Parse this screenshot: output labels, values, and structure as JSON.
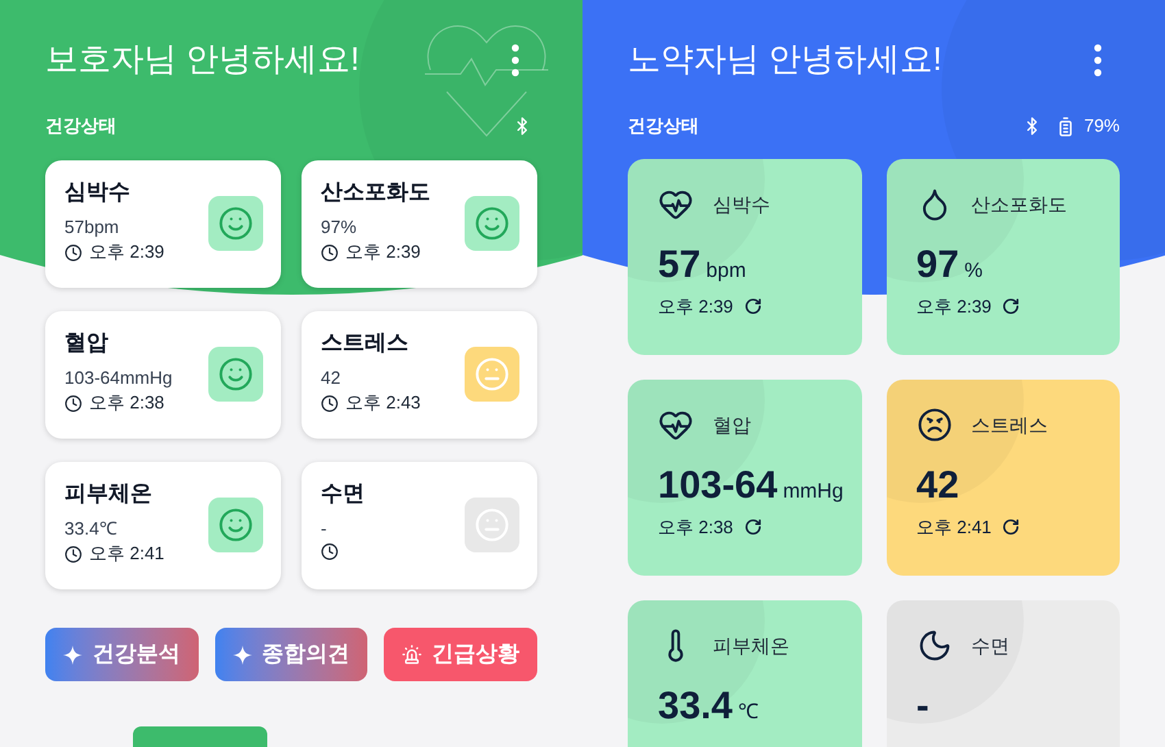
{
  "guardian": {
    "title": "보호자님 안녕하세요!",
    "section": "건강상태",
    "cards": [
      {
        "label": "심박수",
        "value": "57bpm",
        "time": "오후 2:39",
        "kind": "smile",
        "color": "#a3ecc2"
      },
      {
        "label": "산소포화도",
        "value": "97%",
        "time": "오후 2:39",
        "kind": "smile",
        "color": "#a3ecc2"
      },
      {
        "label": "혈압",
        "value": "103-64mmHg",
        "time": "오후 2:38",
        "kind": "smile",
        "color": "#a3ecc2"
      },
      {
        "label": "스트레스",
        "value": "42",
        "time": "오후 2:43",
        "kind": "neutral",
        "color": "#fdd97c"
      },
      {
        "label": "피부체온",
        "value": "33.4℃",
        "time": "오후 2:41",
        "kind": "smile",
        "color": "#a3ecc2"
      },
      {
        "label": "수면",
        "value": "-",
        "kind": "neutral",
        "color": "#e8e8e8"
      }
    ],
    "buttons": [
      {
        "label": "건강분석",
        "kind": "ai"
      },
      {
        "label": "종합의견",
        "kind": "ai"
      },
      {
        "label": "긴급상황",
        "kind": "emergency"
      }
    ]
  },
  "elder": {
    "title": "노약자님 안녕하세요!",
    "section": "건강상태",
    "battery": "79%",
    "cards": [
      {
        "kind": "heart_rate",
        "label": "심박수",
        "value": "57",
        "unit": "bpm",
        "time": "오후 2:39",
        "color": "#a3ecc2"
      },
      {
        "kind": "oxygen",
        "label": "산소포화도",
        "value": "97",
        "unit": "%",
        "time": "오후 2:39",
        "color": "#a3ecc2"
      },
      {
        "kind": "blood_pressure",
        "label": "혈압",
        "value": "103-64",
        "unit": "mmHg",
        "time": "오후 2:38",
        "color": "#a3ecc2"
      },
      {
        "kind": "stress",
        "label": "스트레스",
        "value": "42",
        "time": "오후 2:41",
        "color": "#fdd97c"
      },
      {
        "kind": "temperature",
        "label": "피부체온",
        "value": "33.4",
        "unit": "℃",
        "color": "#a3ecc2"
      },
      {
        "kind": "sleep",
        "label": "수면",
        "value": "-",
        "color": "#ebebeb"
      }
    ]
  }
}
